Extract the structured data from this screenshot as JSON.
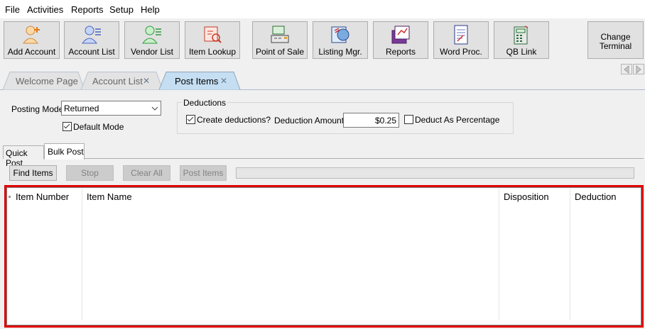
{
  "menu": [
    "File",
    "Activities",
    "Reports",
    "Setup",
    "Help"
  ],
  "toolbar": [
    {
      "label": "Add Account",
      "icon": "add-account-icon"
    },
    {
      "label": "Account List",
      "icon": "account-list-icon"
    },
    {
      "label": "Vendor List",
      "icon": "vendor-list-icon"
    },
    {
      "label": "Item Lookup",
      "icon": "item-lookup-icon"
    },
    {
      "label": "Point of Sale",
      "icon": "point-of-sale-icon"
    },
    {
      "label": "Listing Mgr.",
      "icon": "listing-manager-icon"
    },
    {
      "label": "Reports",
      "icon": "reports-icon"
    },
    {
      "label": "Word Proc.",
      "icon": "word-processor-icon"
    },
    {
      "label": "QB Link",
      "icon": "qb-link-icon"
    }
  ],
  "change_terminal": {
    "line1": "Change",
    "line2": "Terminal"
  },
  "tabs": [
    {
      "label": "Welcome Page",
      "closable": false,
      "active": false
    },
    {
      "label": "Account List",
      "closable": true,
      "active": false
    },
    {
      "label": "Post Items",
      "closable": true,
      "active": true
    }
  ],
  "close_glyph": "✕",
  "posting": {
    "label": "Posting Mode",
    "value": "Returned",
    "default_mode_label": "Default Mode",
    "default_mode_checked": true
  },
  "deductions": {
    "group_label": "Deductions",
    "create_label": "Create deductions?",
    "create_checked": true,
    "amount_label": "Deduction Amount",
    "amount_value": "$0.25",
    "percent_label": "Deduct As Percentage",
    "percent_checked": false
  },
  "subtabs": [
    {
      "label": "Quick Post",
      "active": false
    },
    {
      "label": "Bulk Post",
      "active": true
    }
  ],
  "actions": [
    {
      "label": "Find Items",
      "enabled": true
    },
    {
      "label": "Stop",
      "enabled": false
    },
    {
      "label": "Clear All",
      "enabled": false
    },
    {
      "label": "Post Items",
      "enabled": false
    }
  ],
  "progress_fraction": 0,
  "grid": {
    "columns": [
      "Item Number",
      "Item Name",
      "Disposition",
      "Deduction"
    ],
    "rows": []
  },
  "colors": {
    "highlight_border": "#e00000",
    "active_tab": "#c5def2",
    "tab_border": "#8fa6bc"
  }
}
